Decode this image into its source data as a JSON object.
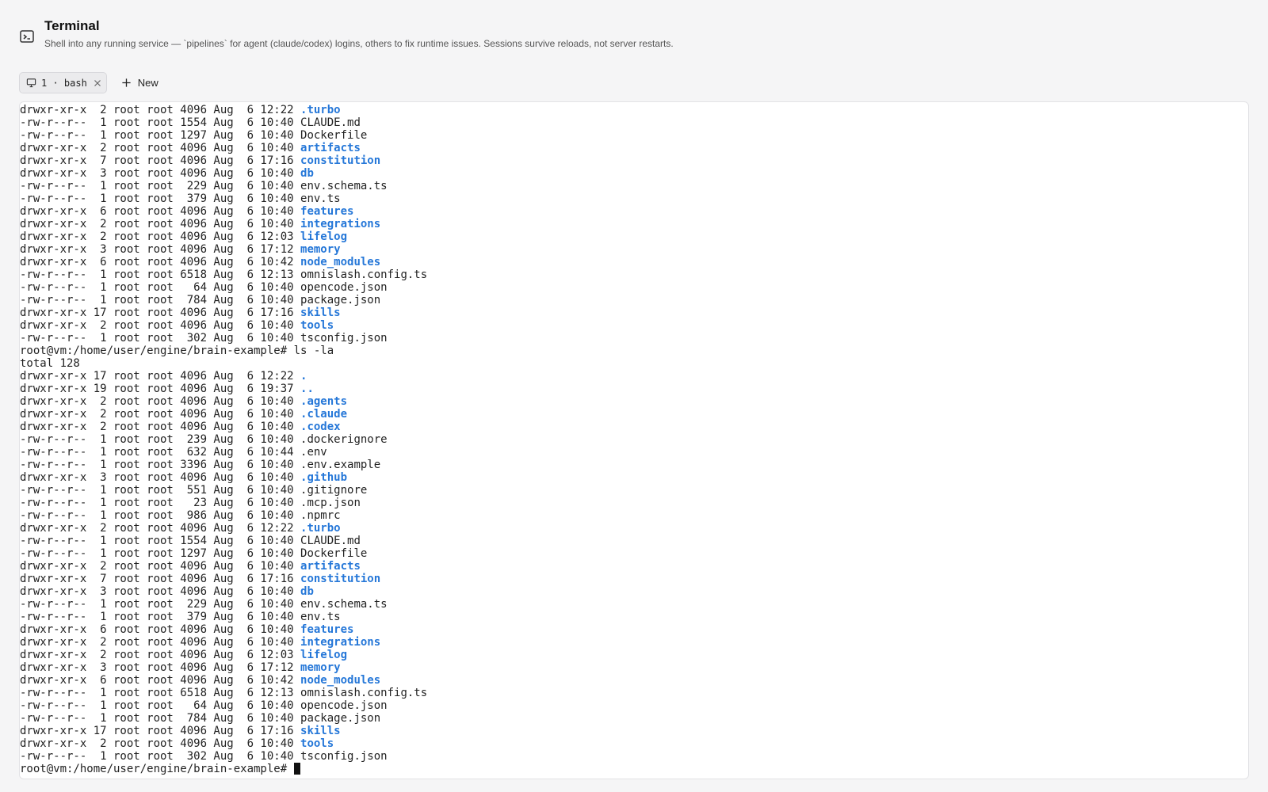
{
  "header": {
    "title": "Terminal",
    "subtitle": "Shell into any running service — `pipelines` for agent (claude/codex) logins, others to fix runtime issues. Sessions survive reloads, not server restarts."
  },
  "tabs": [
    {
      "label": "1 · bash"
    }
  ],
  "new_button": {
    "label": "New"
  },
  "colors": {
    "directory": "#2577d8",
    "background": "#f5f5f6",
    "terminal_bg": "#ffffff"
  },
  "terminal": {
    "lines": [
      {
        "text": "drwxr-xr-x  2 root root 4096 Aug  6 12:22 ",
        "name": ".turbo",
        "dir": true
      },
      {
        "text": "-rw-r--r--  1 root root 1554 Aug  6 10:40 ",
        "name": "CLAUDE.md",
        "dir": false
      },
      {
        "text": "-rw-r--r--  1 root root 1297 Aug  6 10:40 ",
        "name": "Dockerfile",
        "dir": false
      },
      {
        "text": "drwxr-xr-x  2 root root 4096 Aug  6 10:40 ",
        "name": "artifacts",
        "dir": true
      },
      {
        "text": "drwxr-xr-x  7 root root 4096 Aug  6 17:16 ",
        "name": "constitution",
        "dir": true
      },
      {
        "text": "drwxr-xr-x  3 root root 4096 Aug  6 10:40 ",
        "name": "db",
        "dir": true
      },
      {
        "text": "-rw-r--r--  1 root root  229 Aug  6 10:40 ",
        "name": "env.schema.ts",
        "dir": false
      },
      {
        "text": "-rw-r--r--  1 root root  379 Aug  6 10:40 ",
        "name": "env.ts",
        "dir": false
      },
      {
        "text": "drwxr-xr-x  6 root root 4096 Aug  6 10:40 ",
        "name": "features",
        "dir": true
      },
      {
        "text": "drwxr-xr-x  2 root root 4096 Aug  6 10:40 ",
        "name": "integrations",
        "dir": true
      },
      {
        "text": "drwxr-xr-x  2 root root 4096 Aug  6 12:03 ",
        "name": "lifelog",
        "dir": true
      },
      {
        "text": "drwxr-xr-x  3 root root 4096 Aug  6 17:12 ",
        "name": "memory",
        "dir": true
      },
      {
        "text": "drwxr-xr-x  6 root root 4096 Aug  6 10:42 ",
        "name": "node_modules",
        "dir": true
      },
      {
        "text": "-rw-r--r--  1 root root 6518 Aug  6 12:13 ",
        "name": "omnislash.config.ts",
        "dir": false
      },
      {
        "text": "-rw-r--r--  1 root root   64 Aug  6 10:40 ",
        "name": "opencode.json",
        "dir": false
      },
      {
        "text": "-rw-r--r--  1 root root  784 Aug  6 10:40 ",
        "name": "package.json",
        "dir": false
      },
      {
        "text": "drwxr-xr-x 17 root root 4096 Aug  6 17:16 ",
        "name": "skills",
        "dir": true
      },
      {
        "text": "drwxr-xr-x  2 root root 4096 Aug  6 10:40 ",
        "name": "tools",
        "dir": true
      },
      {
        "text": "-rw-r--r--  1 root root  302 Aug  6 10:40 ",
        "name": "tsconfig.json",
        "dir": false
      },
      {
        "text": "root@vm:/home/user/engine/brain-example# ls -la",
        "name": "",
        "dir": false
      },
      {
        "text": "total 128",
        "name": "",
        "dir": false
      },
      {
        "text": "drwxr-xr-x 17 root root 4096 Aug  6 12:22 ",
        "name": ".",
        "dir": true
      },
      {
        "text": "drwxr-xr-x 19 root root 4096 Aug  6 19:37 ",
        "name": "..",
        "dir": true
      },
      {
        "text": "drwxr-xr-x  2 root root 4096 Aug  6 10:40 ",
        "name": ".agents",
        "dir": true
      },
      {
        "text": "drwxr-xr-x  2 root root 4096 Aug  6 10:40 ",
        "name": ".claude",
        "dir": true
      },
      {
        "text": "drwxr-xr-x  2 root root 4096 Aug  6 10:40 ",
        "name": ".codex",
        "dir": true
      },
      {
        "text": "-rw-r--r--  1 root root  239 Aug  6 10:40 ",
        "name": ".dockerignore",
        "dir": false
      },
      {
        "text": "-rw-r--r--  1 root root  632 Aug  6 10:44 ",
        "name": ".env",
        "dir": false
      },
      {
        "text": "-rw-r--r--  1 root root 3396 Aug  6 10:40 ",
        "name": ".env.example",
        "dir": false
      },
      {
        "text": "drwxr-xr-x  3 root root 4096 Aug  6 10:40 ",
        "name": ".github",
        "dir": true
      },
      {
        "text": "-rw-r--r--  1 root root  551 Aug  6 10:40 ",
        "name": ".gitignore",
        "dir": false
      },
      {
        "text": "-rw-r--r--  1 root root   23 Aug  6 10:40 ",
        "name": ".mcp.json",
        "dir": false
      },
      {
        "text": "-rw-r--r--  1 root root  986 Aug  6 10:40 ",
        "name": ".npmrc",
        "dir": false
      },
      {
        "text": "drwxr-xr-x  2 root root 4096 Aug  6 12:22 ",
        "name": ".turbo",
        "dir": true
      },
      {
        "text": "-rw-r--r--  1 root root 1554 Aug  6 10:40 ",
        "name": "CLAUDE.md",
        "dir": false
      },
      {
        "text": "-rw-r--r--  1 root root 1297 Aug  6 10:40 ",
        "name": "Dockerfile",
        "dir": false
      },
      {
        "text": "drwxr-xr-x  2 root root 4096 Aug  6 10:40 ",
        "name": "artifacts",
        "dir": true
      },
      {
        "text": "drwxr-xr-x  7 root root 4096 Aug  6 17:16 ",
        "name": "constitution",
        "dir": true
      },
      {
        "text": "drwxr-xr-x  3 root root 4096 Aug  6 10:40 ",
        "name": "db",
        "dir": true
      },
      {
        "text": "-rw-r--r--  1 root root  229 Aug  6 10:40 ",
        "name": "env.schema.ts",
        "dir": false
      },
      {
        "text": "-rw-r--r--  1 root root  379 Aug  6 10:40 ",
        "name": "env.ts",
        "dir": false
      },
      {
        "text": "drwxr-xr-x  6 root root 4096 Aug  6 10:40 ",
        "name": "features",
        "dir": true
      },
      {
        "text": "drwxr-xr-x  2 root root 4096 Aug  6 10:40 ",
        "name": "integrations",
        "dir": true
      },
      {
        "text": "drwxr-xr-x  2 root root 4096 Aug  6 12:03 ",
        "name": "lifelog",
        "dir": true
      },
      {
        "text": "drwxr-xr-x  3 root root 4096 Aug  6 17:12 ",
        "name": "memory",
        "dir": true
      },
      {
        "text": "drwxr-xr-x  6 root root 4096 Aug  6 10:42 ",
        "name": "node_modules",
        "dir": true
      },
      {
        "text": "-rw-r--r--  1 root root 6518 Aug  6 12:13 ",
        "name": "omnislash.config.ts",
        "dir": false
      },
      {
        "text": "-rw-r--r--  1 root root   64 Aug  6 10:40 ",
        "name": "opencode.json",
        "dir": false
      },
      {
        "text": "-rw-r--r--  1 root root  784 Aug  6 10:40 ",
        "name": "package.json",
        "dir": false
      },
      {
        "text": "drwxr-xr-x 17 root root 4096 Aug  6 17:16 ",
        "name": "skills",
        "dir": true
      },
      {
        "text": "drwxr-xr-x  2 root root 4096 Aug  6 10:40 ",
        "name": "tools",
        "dir": true
      },
      {
        "text": "-rw-r--r--  1 root root  302 Aug  6 10:40 ",
        "name": "tsconfig.json",
        "dir": false
      }
    ],
    "prompt": "root@vm:/home/user/engine/brain-example# "
  }
}
